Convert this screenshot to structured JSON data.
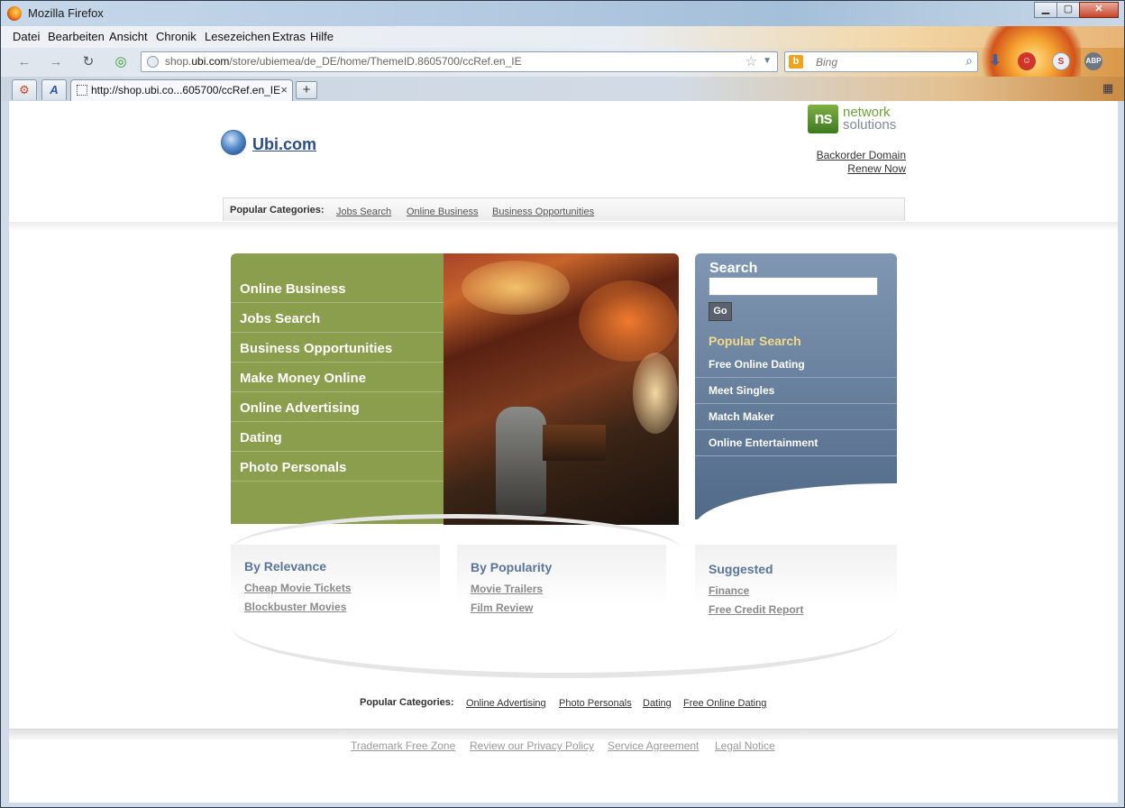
{
  "window": {
    "title": "Mozilla Firefox",
    "controls": [
      "minimize",
      "maximize",
      "close"
    ]
  },
  "menu": [
    "Datei",
    "Bearbeiten",
    "Ansicht",
    "Chronik",
    "Lesezeichen",
    "Extras",
    "Hilfe"
  ],
  "navigation": {
    "url_prefix": "shop.",
    "url_domain": "ubi.com",
    "url_rest": "/store/ubiemea/de_DE/home/ThemeID.8605700/ccRef.en_IE",
    "search_engine": "b",
    "search_placeholder": "Bing"
  },
  "tabs": {
    "active_label": "http://shop.ubi.co...605700/ccRef.en_IE",
    "close_glyph": "×",
    "new_tab_glyph": "+"
  },
  "page": {
    "site_name": "Ubi.com",
    "ns_mark": "ns",
    "ns_line1": "network",
    "ns_line2": "solutions",
    "backorder": "Backorder Domain",
    "renew": "Renew Now",
    "popular_title": "Popular Categories:",
    "popular_links": [
      "Jobs Search",
      "Online Business",
      "Business Opportunities"
    ],
    "main_categories": [
      "Online Business",
      "Jobs Search",
      "Business Opportunities",
      "Make Money Online",
      "Online Advertising",
      "Dating",
      "Photo Personals"
    ],
    "search": {
      "title": "Search",
      "go_label": "Go",
      "popular_title": "Popular Search",
      "items": [
        "Free Online Dating",
        "Meet Singles",
        "Match Maker",
        "Online Entertainment"
      ]
    },
    "by_relevance": {
      "title": "By Relevance",
      "links": [
        "Cheap Movie Tickets",
        "Blockbuster Movies"
      ]
    },
    "by_popularity": {
      "title": "By Popularity",
      "links": [
        "Movie Trailers",
        "Film Review"
      ]
    },
    "suggested": {
      "title": "Suggested",
      "links": [
        "Finance",
        "Free Credit Report"
      ]
    },
    "bottom_popular_title": "Popular Categories:",
    "bottom_popular_links": [
      "Online Advertising",
      "Photo Personals",
      "Dating",
      "Free Online Dating"
    ],
    "footer_links": [
      "Trademark Free Zone",
      "Review our Privacy Policy",
      "Service Agreement",
      "Legal Notice"
    ]
  },
  "colors": {
    "green_panel": "#8a9e4d",
    "blue_panel": "#647c9a",
    "link_blue": "#2d4d86",
    "popular_search_gold": "#f2d98a"
  }
}
